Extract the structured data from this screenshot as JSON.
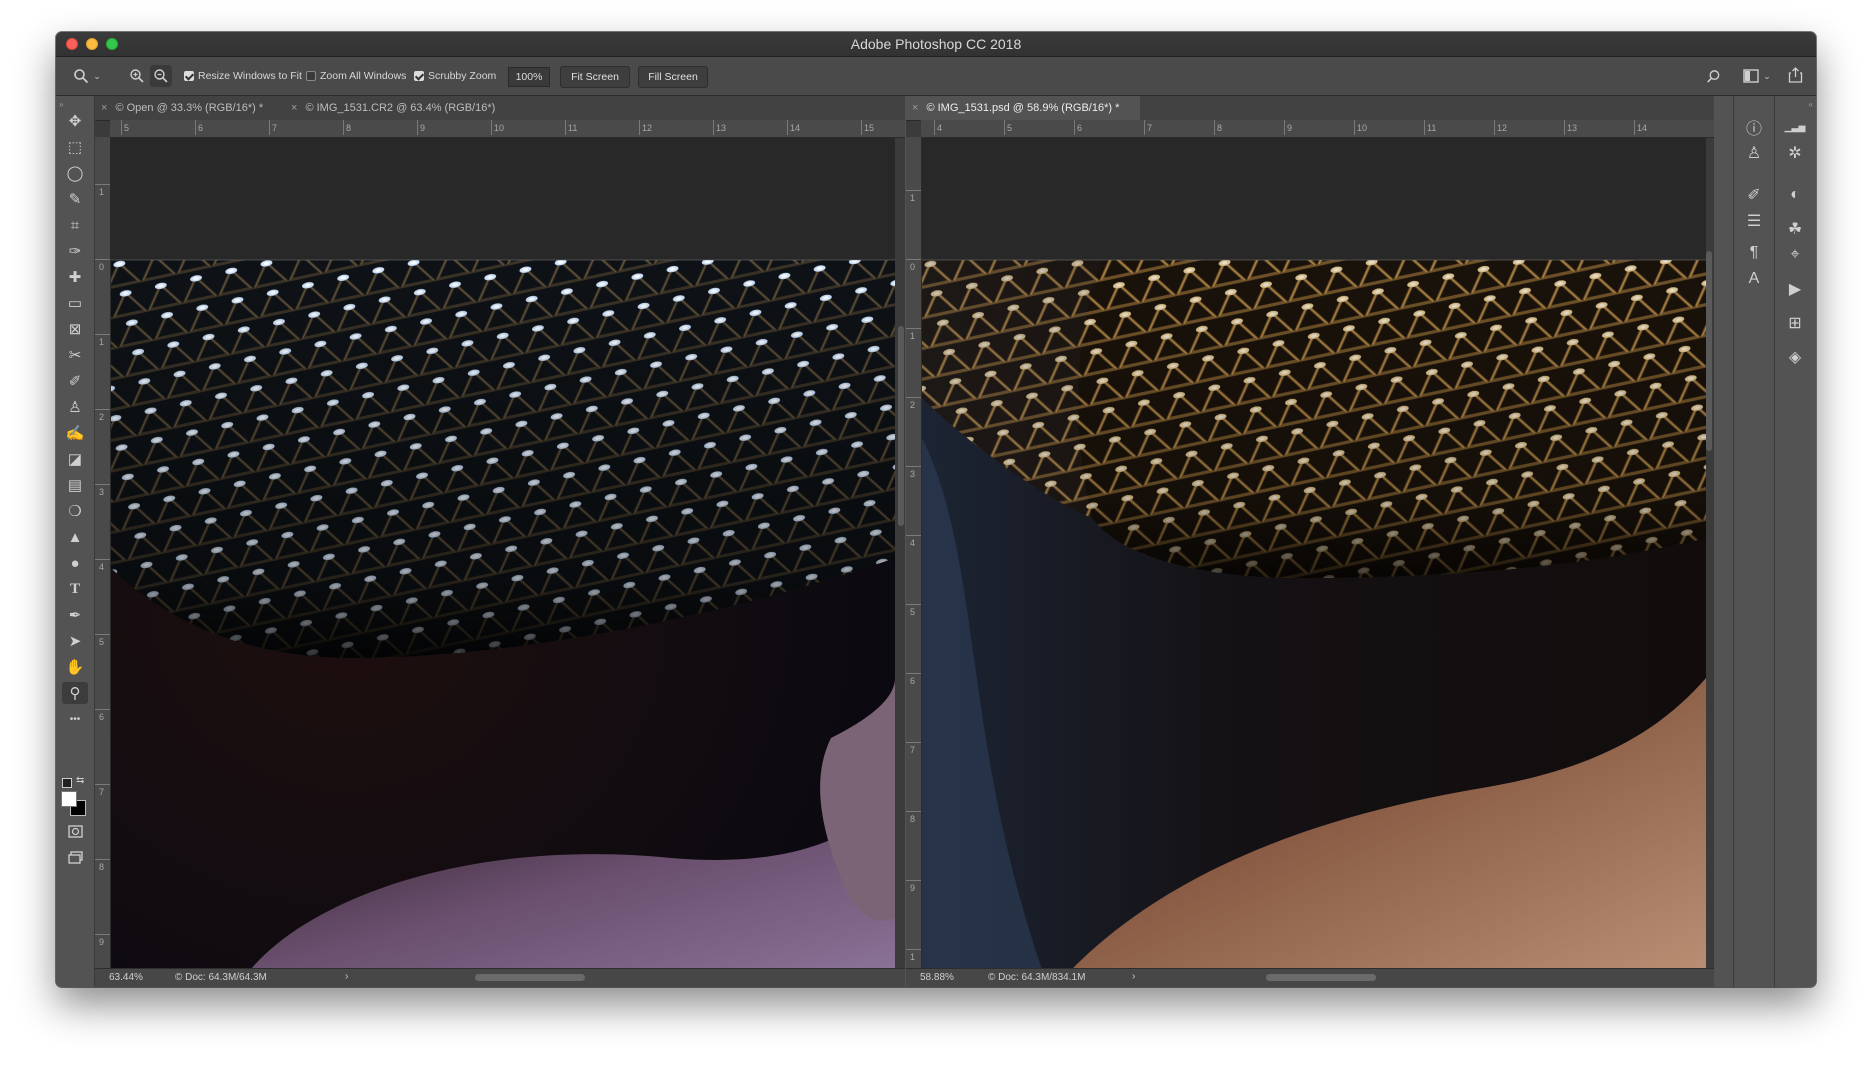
{
  "app": {
    "title": "Adobe Photoshop CC 2018"
  },
  "options_bar": {
    "resize_windows_label": "Resize Windows to Fit",
    "resize_windows_checked": true,
    "zoom_all_label": "Zoom All Windows",
    "zoom_all_checked": false,
    "scrubby_zoom_label": "Scrubby Zoom",
    "scrubby_zoom_checked": true,
    "zoom_value": "100%",
    "fit_screen_label": "Fit Screen",
    "fill_screen_label": "Fill Screen"
  },
  "tools": [
    {
      "name": "move-tool-icon",
      "glyph": "✥"
    },
    {
      "name": "marquee-tool-icon",
      "glyph": "⬚"
    },
    {
      "name": "lasso-tool-icon",
      "glyph": "◯"
    },
    {
      "name": "quick-selection-tool-icon",
      "glyph": "✎"
    },
    {
      "name": "crop-tool-icon",
      "glyph": "⌗"
    },
    {
      "name": "eyedropper-tool-icon",
      "glyph": "✑"
    },
    {
      "name": "healing-brush-tool-icon",
      "glyph": "✚"
    },
    {
      "name": "ruler-tool-icon",
      "glyph": "▭"
    },
    {
      "name": "frame-tool-icon",
      "glyph": "⊠"
    },
    {
      "name": "patch-tool-icon",
      "glyph": "✂"
    },
    {
      "name": "brush-tool-icon",
      "glyph": "✐"
    },
    {
      "name": "clone-stamp-tool-icon",
      "glyph": "♙"
    },
    {
      "name": "history-brush-tool-icon",
      "glyph": "✍"
    },
    {
      "name": "eraser-tool-icon",
      "glyph": "◪"
    },
    {
      "name": "gradient-tool-icon",
      "glyph": "▤"
    },
    {
      "name": "blur-tool-icon",
      "glyph": "❍"
    },
    {
      "name": "sharpen-tool-icon",
      "glyph": "▲"
    },
    {
      "name": "dodge-tool-icon",
      "glyph": "●"
    },
    {
      "name": "type-tool-icon",
      "glyph": "T"
    },
    {
      "name": "pen-tool-icon",
      "glyph": "✒"
    },
    {
      "name": "path-selection-tool-icon",
      "glyph": "➤"
    },
    {
      "name": "hand-tool-icon",
      "glyph": "✋"
    },
    {
      "name": "zoom-tool-icon",
      "glyph": "⚲"
    },
    {
      "name": "more-tools-icon",
      "glyph": "•••"
    }
  ],
  "left_doc": {
    "tabs": [
      {
        "label": "© Open @ 33.3% (RGB/16*) *"
      },
      {
        "label": "© IMG_1531.CR2 @ 63.4% (RGB/16*)"
      }
    ],
    "ruler_h": [
      "5",
      "6",
      "7",
      "8",
      "9",
      "10",
      "11",
      "12",
      "13",
      "14",
      "15"
    ],
    "ruler_v": [
      "1",
      "0",
      "1",
      "2",
      "3",
      "4",
      "5",
      "6",
      "7",
      "8",
      "9"
    ],
    "zoom": "63.44%",
    "doc_info": "© Doc: 64.3M/64.3M",
    "arrow": "›"
  },
  "right_doc": {
    "tabs": [
      {
        "label": "© IMG_1531.psd @ 58.9% (RGB/16*) *"
      }
    ],
    "ruler_h": [
      "4",
      "5",
      "6",
      "7",
      "8",
      "9",
      "10",
      "11",
      "12",
      "13",
      "14"
    ],
    "ruler_v": [
      "1",
      "0",
      "1",
      "2",
      "3",
      "4",
      "5",
      "6",
      "7",
      "8",
      "9",
      "1"
    ],
    "zoom": "58.88%",
    "doc_info": "© Doc: 64.3M/834.1M",
    "arrow": "›"
  },
  "dock": {
    "column_a": [
      "info-panel-icon",
      "clone-source-panel-icon",
      "brush-settings-panel-icon",
      "properties-panel-icon",
      "paragraph-styles-panel-icon",
      "character-panel-icon"
    ],
    "column_b": [
      "histogram-panel-icon",
      "navigator-panel-icon",
      "adjustments-panel-icon",
      "color-panel-icon",
      "paths-panel-icon",
      "actions-panel-icon",
      "libraries-panel-icon",
      "layers-panel-icon"
    ]
  }
}
